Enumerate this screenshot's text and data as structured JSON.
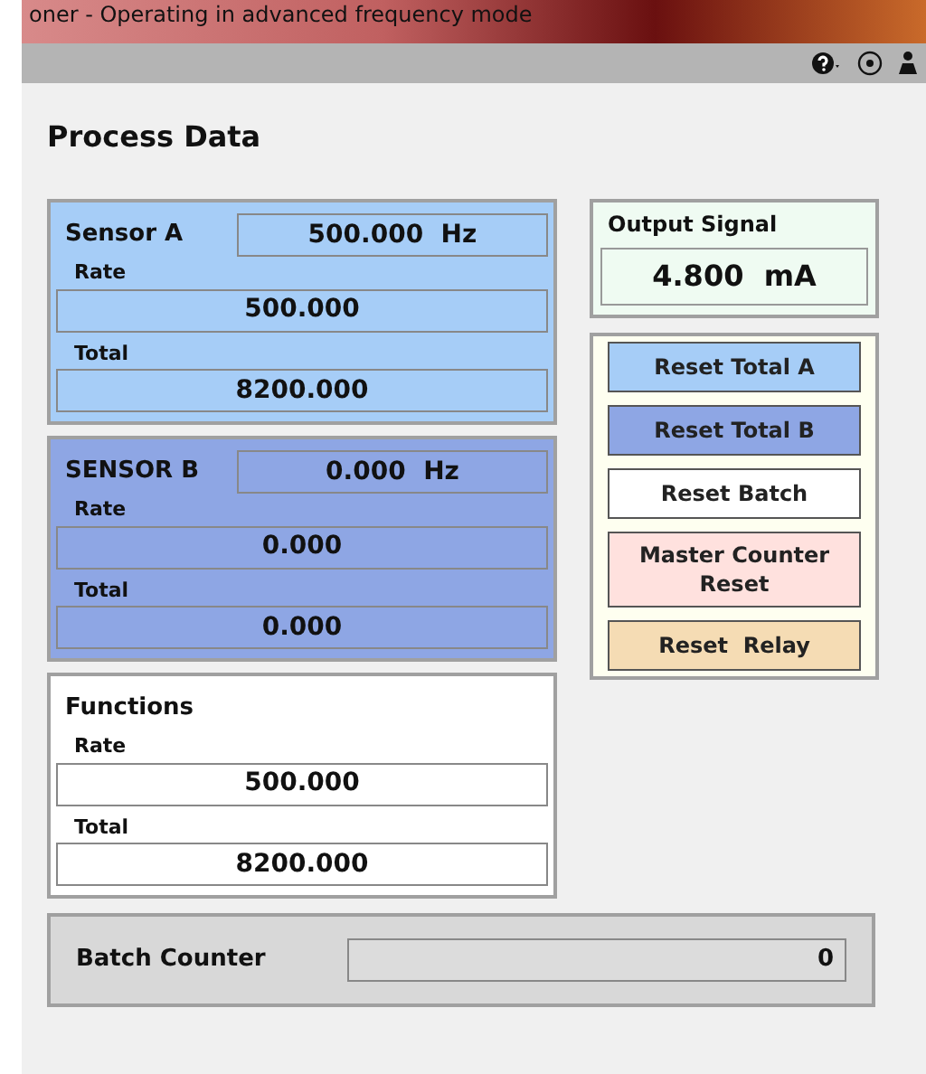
{
  "window": {
    "title": "oner - Operating in advanced frequency mode"
  },
  "page_title": "Process Data",
  "sensors": [
    {
      "name": "Sensor A",
      "frequency": "500.000  Hz",
      "color": "#a6cdf7",
      "rate_label": "Rate",
      "rate": "500.000",
      "total_label": "Total",
      "total": "8200.000"
    },
    {
      "name": "SENSOR B",
      "frequency": "0.000  Hz",
      "color": "#8ea6e4",
      "rate_label": "Rate",
      "rate": "0.000",
      "total_label": "Total",
      "total": "0.000"
    },
    {
      "name": "Functions",
      "color": "#ffffff",
      "rate_label": "Rate",
      "rate": "500.000",
      "total_label": "Total",
      "total": "8200.000"
    }
  ],
  "output_signal": {
    "label": "Output Signal",
    "value": "4.800  mA"
  },
  "buttons": [
    {
      "label": "Reset Total A",
      "color": "#a6cdf7"
    },
    {
      "label": "Reset Total B",
      "color": "#8ea6e4"
    },
    {
      "label": "Reset Batch",
      "color": "#ffffff"
    },
    {
      "label": "Master Counter Reset",
      "color": "#ffe1de"
    },
    {
      "label": "Reset  Relay",
      "color": "#f5dcb4"
    }
  ],
  "batch_counter": {
    "label": "Batch Counter",
    "value": "0"
  }
}
